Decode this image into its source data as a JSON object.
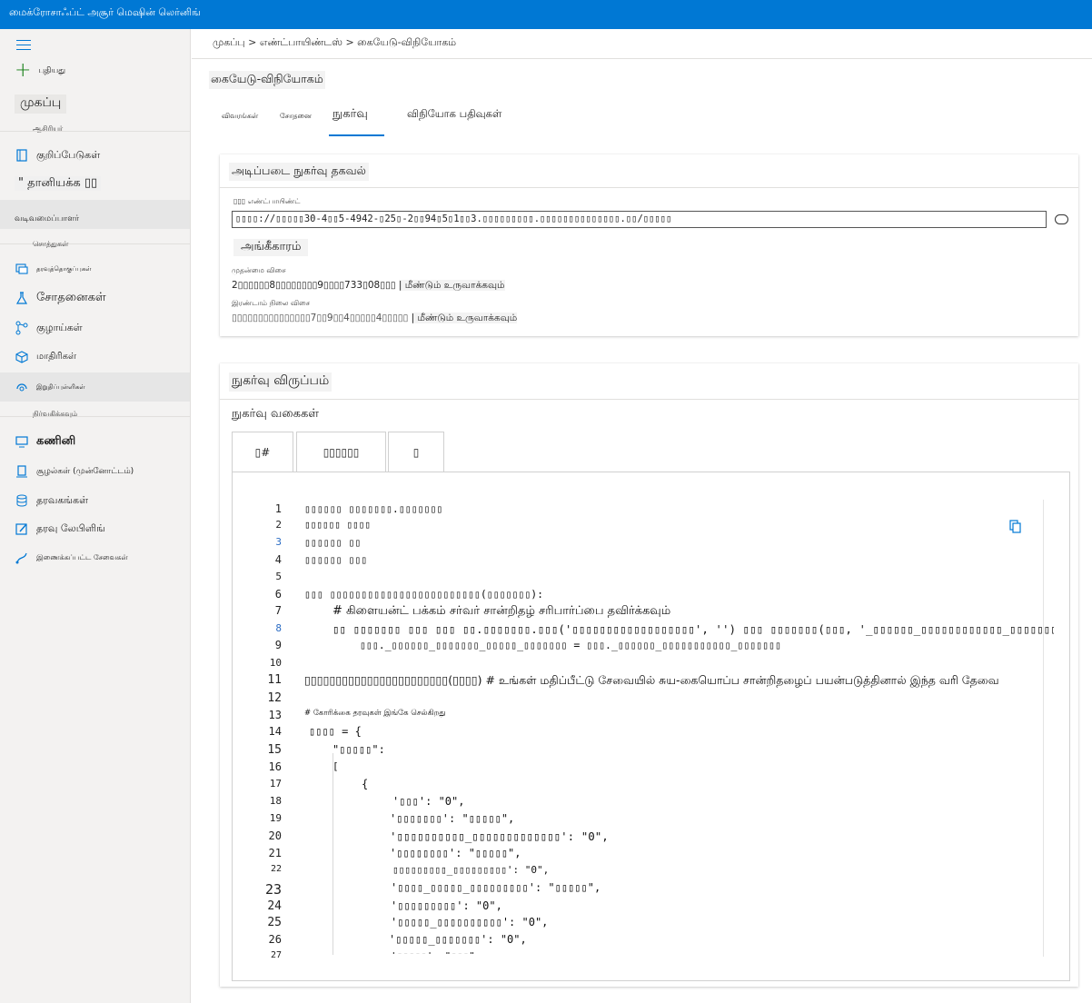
{
  "topbar": {
    "title": "மைக்ரோசாஃப்ட் அசூர் மெஷின் லெர்னிங்"
  },
  "sidebar": {
    "new_label": "புதியது",
    "home_label": "முகப்பு",
    "section_author": "ஆசிரியர்",
    "notebooks": "குறிப்பேடுகள்",
    "automl": "\" தானியக்க ▯▯",
    "designer": "வடிவமைப்பாளர்",
    "section_assets": "சொத்துகள்",
    "datasets_small": "தரவுத்தொகுப்புகள்",
    "experiments": "சோதனைகள்",
    "pipelines": "குழாய்கள்",
    "models": "மாதிரிகள்",
    "endpoints": "இறுதிப்புள்ளிகள்",
    "section_manage": "நிர்வகிக்கவும்",
    "compute": "கணினி",
    "environments": "சூழல்கள் (முன்னோட்டம்)",
    "datastores": "தரவகங்கள்",
    "data_labeling": "தரவு லேபிளிங்",
    "linked_services": "இணைக்கப்பட்ட சேவைகள்"
  },
  "breadcrumb": "முகப்பு > எண்ட்பாயிண்டஸ் > கையேடு-விநியோகம்",
  "page": {
    "title": "கையேடு-விநியோகம்",
    "tabs": [
      "விவரங்கள்",
      "சோதனை",
      "நுகர்வு",
      "விநியோக பதிவுகள்"
    ]
  },
  "basic_info": {
    "title": "அடிப்படை நுகர்வு தகவல்",
    "endpoint_label": "▯▯▯ எண்ட்பாயிண்ட்",
    "endpoint_value": "▯▯▯▯://▯▯▯▯▯30-4▯▯5-4942-▯25▯-2▯▯94▯5▯1▯▯3.▯▯▯▯▯▯▯▯▯.▯▯▯▯▯▯▯▯▯▯▯▯▯▯.▯▯/▯▯▯▯▯",
    "auth_heading": "அங்கீகாரம்",
    "primary_key_label": "முதன்மை விசை",
    "primary_key_value": "2▯▯▯▯▯▯8▯▯▯▯▯▯▯▯9▯▯▯▯733▯08▯▯▯",
    "secondary_key_label": "இரண்டாம் நிலை விசை",
    "secondary_key_value": "▯▯▯▯▯▯▯▯▯▯▯▯▯▯▯7▯▯9▯▯4▯▯▯▯▯4▯▯▯▯▯",
    "regenerate": "| மீண்டும் உருவாக்கவும்"
  },
  "consume": {
    "title": "நுகர்வு விருப்பம்",
    "types_label": "நுகர்வு வகைகள்",
    "code_tabs": [
      "▯#",
      "▯▯▯▯▯▯",
      "▯"
    ],
    "line_numbers": [
      "1",
      "2",
      "3",
      "4",
      "5",
      "6",
      "7",
      "8",
      "9",
      "10",
      "11",
      "12",
      "13",
      "14",
      "15",
      "16",
      "17",
      "18",
      "19",
      "20",
      "21",
      "22",
      "23",
      "24",
      "25",
      "26",
      "27"
    ],
    "code_lines": [
      "▯▯▯▯▯▯ ▯▯▯▯▯▯▯.▯▯▯▯▯▯▯",
      "▯▯▯▯▯▯ ▯▯▯▯",
      "▯▯▯▯▯▯ ▯▯",
      "▯▯▯▯▯▯ ▯▯▯",
      "",
      "▯▯▯ ▯▯▯▯▯▯▯▯▯▯▯▯▯▯▯▯▯▯▯▯▯▯▯▯(▯▯▯▯▯▯▯):",
      "# கிளையன்ட் பக்கம் சர்வர் சான்றிதழ் சரிபார்ப்பை தவிர்க்கவும்",
      "▯▯ ▯▯▯▯▯▯▯ ▯▯▯ ▯▯▯ ▯▯.▯▯▯▯▯▯▯.▯▯▯('▯▯▯▯▯▯▯▯▯▯▯▯▯▯▯▯▯▯', '') ▯▯▯ ▯▯▯▯▯▯▯(▯▯▯, '_▯▯▯▯▯▯_▯▯▯▯▯▯▯▯▯▯▯▯_▯▯▯▯▯▯▯",
      "▯▯▯._▯▯▯▯▯▯_▯▯▯▯▯▯▯_▯▯▯▯▯_▯▯▯▯▯▯▯ = ▯▯▯._▯▯▯▯▯▯_▯▯▯▯▯▯▯▯▯▯▯_▯▯▯▯▯▯▯",
      "",
      "▯▯▯▯▯▯▯▯▯▯▯▯▯▯▯▯▯▯▯▯▯▯▯(▯▯▯▯) # உங்கள் மதிப்பீட்டு சேவையில் சுய-கையொப்ப சான்றிதழைப் பயன்படுத்தினால் இந்த வரி தேவை",
      "",
      "# கோரிக்கை தரவுகள் இங்கே செல்கிறது",
      "▯▯▯▯ = {",
      "\"▯▯▯▯▯\":",
      "[",
      "{",
      "'▯▯▯': \"0\",",
      "'▯▯▯▯▯▯▯': \"▯▯▯▯▯\",",
      "'▯▯▯▯▯▯▯▯▯▯_▯▯▯▯▯▯▯▯▯▯▯▯▯': \"0\",",
      "'▯▯▯▯▯▯▯▯': \"▯▯▯▯▯\",",
      "▯▯▯▯▯▯▯▯▯_▯▯▯▯▯▯▯▯▯': \"0\",",
      "'▯▯▯▯_▯▯▯▯▯_▯▯▯▯▯▯▯▯▯': \"▯▯▯▯▯\",",
      "'▯▯▯▯▯▯▯▯▯': \"0\",",
      "'▯▯▯▯▯_▯▯▯▯▯▯▯▯▯▯': \"0\",",
      "'▯▯▯▯▯_▯▯▯▯▯▯▯': \"0\",",
      "'▯▯▯▯▯': \"▯▯▯\","
    ]
  }
}
